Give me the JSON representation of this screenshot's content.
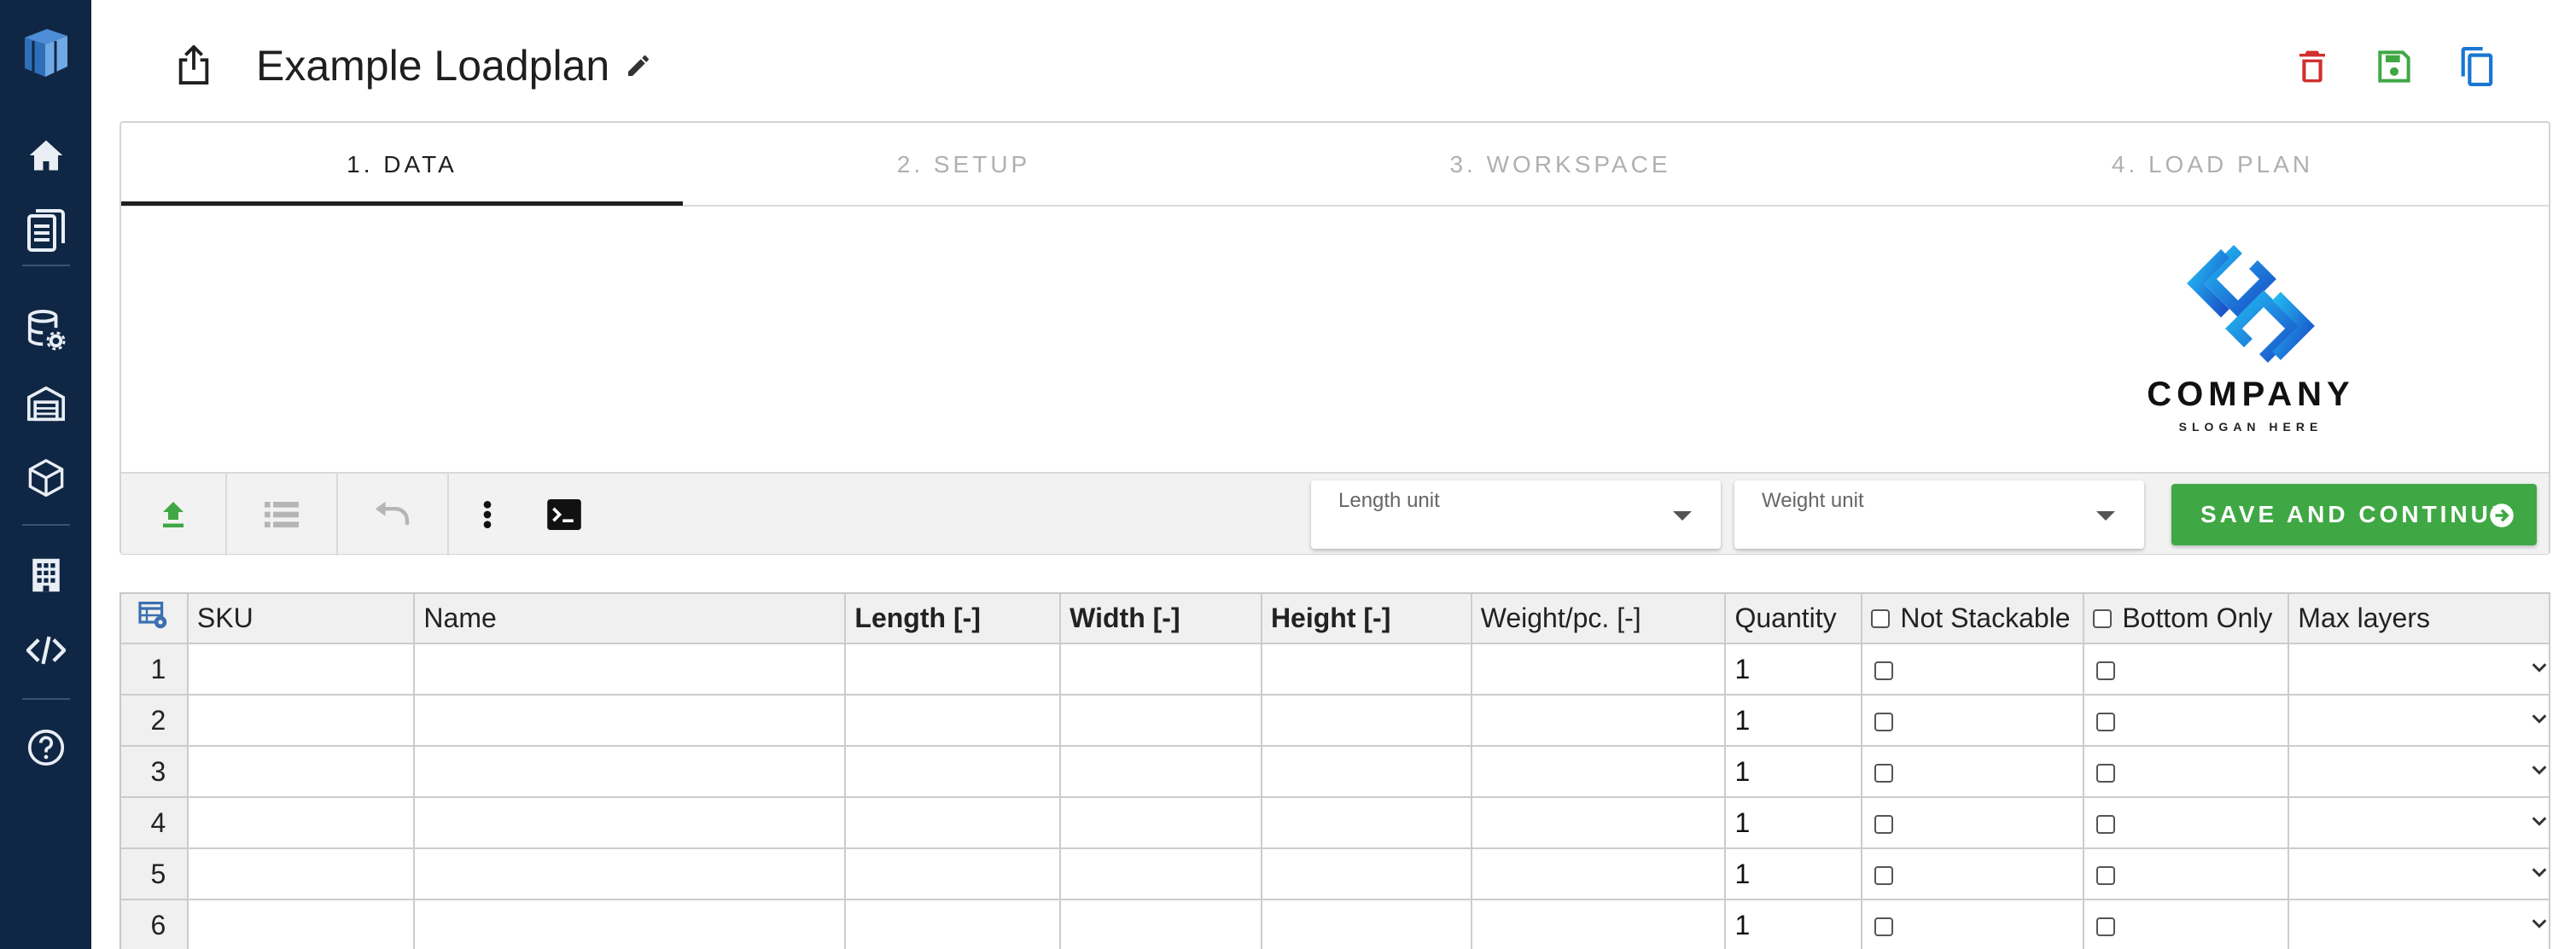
{
  "sidebar": {
    "items": [
      {
        "icon": "app-logo-icon"
      },
      {
        "icon": "home-icon"
      },
      {
        "icon": "documents-icon"
      },
      {
        "icon": "database-settings-icon"
      },
      {
        "icon": "warehouse-icon"
      },
      {
        "icon": "package-icon"
      },
      {
        "icon": "building-icon"
      },
      {
        "icon": "code-icon"
      },
      {
        "icon": "help-icon"
      }
    ]
  },
  "header": {
    "title": "Example Loadplan",
    "actions": [
      {
        "icon": "delete-icon",
        "color": "#d32f2f"
      },
      {
        "icon": "save-icon",
        "color": "#3fa844"
      },
      {
        "icon": "copy-icon",
        "color": "#1976d2"
      }
    ]
  },
  "tabs": [
    {
      "label": "1. DATA",
      "active": true
    },
    {
      "label": "2. SETUP",
      "active": false
    },
    {
      "label": "3. WORKSPACE",
      "active": false
    },
    {
      "label": "4. LOAD PLAN",
      "active": false
    }
  ],
  "logo": {
    "name": "COMPANY",
    "slogan": "SLOGAN HERE"
  },
  "toolbar": {
    "length_unit_label": "Length unit",
    "weight_unit_label": "Weight unit",
    "save_label": "SAVE AND CONTINUE",
    "accent_color": "#3fa844"
  },
  "table": {
    "columns": [
      "SKU",
      "Name",
      "Length [-]",
      "Width [-]",
      "Height [-]",
      "Weight/pc. [-]",
      "Quantity",
      "Not Stackable",
      "Bottom Only",
      "Max layers"
    ],
    "rows": [
      {
        "num": "1",
        "quantity": "1"
      },
      {
        "num": "2",
        "quantity": "1"
      },
      {
        "num": "3",
        "quantity": "1"
      },
      {
        "num": "4",
        "quantity": "1"
      },
      {
        "num": "5",
        "quantity": "1"
      },
      {
        "num": "6",
        "quantity": "1"
      }
    ]
  }
}
